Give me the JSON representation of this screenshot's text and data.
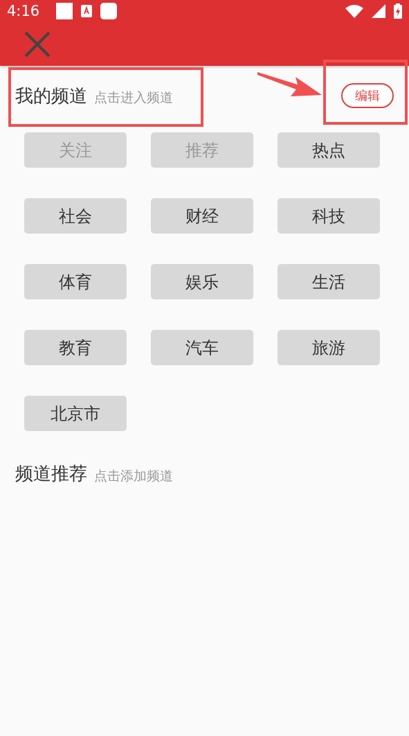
{
  "status_bar": {
    "time": "4:16"
  },
  "my_channels": {
    "title": "我的频道",
    "hint": "点击进入频道",
    "edit_button": "编辑",
    "items": [
      {
        "label": "关注",
        "disabled": true
      },
      {
        "label": "推荐",
        "disabled": true
      },
      {
        "label": "热点",
        "disabled": false
      },
      {
        "label": "社会",
        "disabled": false
      },
      {
        "label": "财经",
        "disabled": false
      },
      {
        "label": "科技",
        "disabled": false
      },
      {
        "label": "体育",
        "disabled": false
      },
      {
        "label": "娱乐",
        "disabled": false
      },
      {
        "label": "生活",
        "disabled": false
      },
      {
        "label": "教育",
        "disabled": false
      },
      {
        "label": "汽车",
        "disabled": false
      },
      {
        "label": "旅游",
        "disabled": false
      },
      {
        "label": "北京市",
        "disabled": false
      }
    ]
  },
  "recommended": {
    "title": "频道推荐",
    "hint": "点击添加频道"
  }
}
